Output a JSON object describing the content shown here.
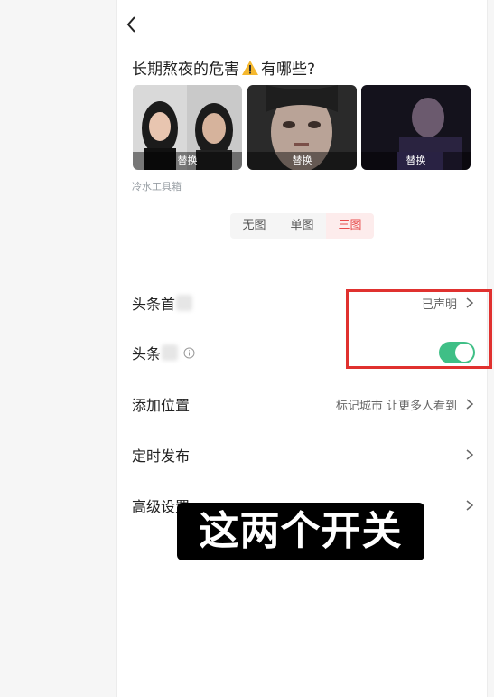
{
  "header": {
    "back_icon": "chevron-left-icon"
  },
  "article": {
    "title_before": "长期熬夜的危害",
    "title_icon": "warning-icon",
    "title_after": "有哪些?",
    "thumbnails": [
      {
        "replace_label": "替换"
      },
      {
        "replace_label": "替换"
      },
      {
        "replace_label": "替换"
      }
    ],
    "source": "冷水工具箱"
  },
  "image_mode": {
    "options": [
      "无图",
      "单图",
      "三图"
    ],
    "selected": "三图"
  },
  "settings": {
    "first_publish": {
      "label": "头条首",
      "value": "已声明"
    },
    "exclusive": {
      "label": "头条",
      "toggle_on": true
    },
    "location": {
      "label": "添加位置",
      "value": "标记城市 让更多人看到"
    },
    "scheduled": {
      "label": "定时发布"
    },
    "advanced": {
      "label": "高级设置"
    }
  },
  "overlay": {
    "caption": "这两个开关"
  },
  "colors": {
    "accent_red": "#e84b4b",
    "toggle_green": "#3fbf86",
    "highlight_box": "#e0312f"
  }
}
